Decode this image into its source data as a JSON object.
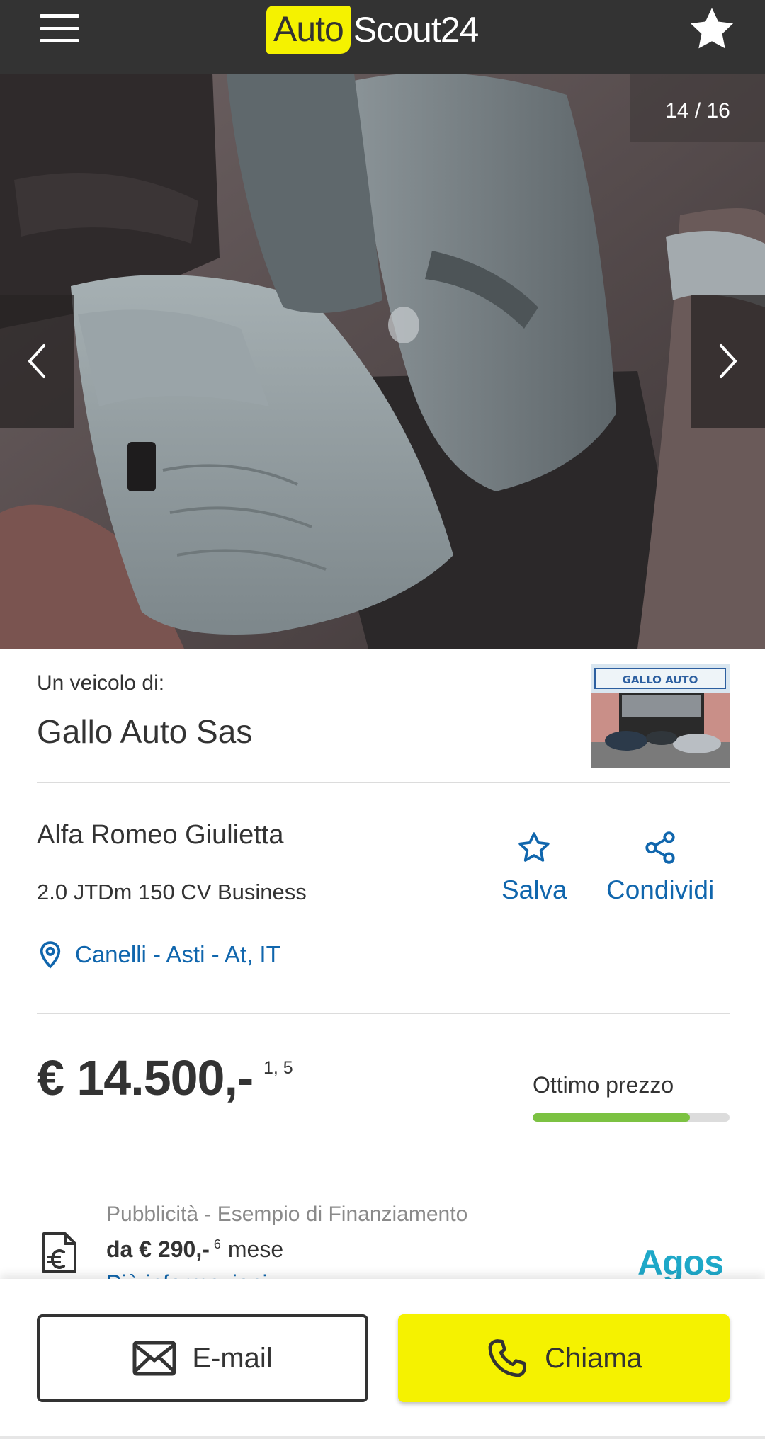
{
  "header": {
    "menu_icon": "hamburger-menu-icon",
    "logo_part1": "Auto",
    "logo_part2": "Scout24",
    "favorite_icon": "star-icon",
    "colors": {
      "bar": "#333333",
      "brand_yellow": "#f5f200"
    }
  },
  "gallery": {
    "counter": "14 / 16",
    "prev_icon": "chevron-left-icon",
    "next_icon": "chevron-right-icon"
  },
  "dealer": {
    "label": "Un veicolo di:",
    "name": "Gallo Auto Sas",
    "photo_sign": "GALLO AUTO"
  },
  "vehicle": {
    "title": "Alfa Romeo Giulietta",
    "subtitle": "2.0 JTDm 150 CV Business",
    "location": "Canelli - Asti - At, IT",
    "save_label": "Salva",
    "share_label": "Condividi",
    "link_color": "#1066ad"
  },
  "price": {
    "amount": "€ 14.500,-",
    "footnotes": "1, 5",
    "rating_label": "Ottimo prezzo",
    "rating_level": 0.8,
    "rating_color": "#7cc242"
  },
  "financing": {
    "label": "Pubblicità - Esempio di Finanziamento",
    "amount": "da € 290,-",
    "footnote": "6",
    "period": "mese",
    "more_link": "Più informazioni",
    "partner_logo": "Agos"
  },
  "actions": {
    "email_label": "E-mail",
    "call_label": "Chiama"
  }
}
